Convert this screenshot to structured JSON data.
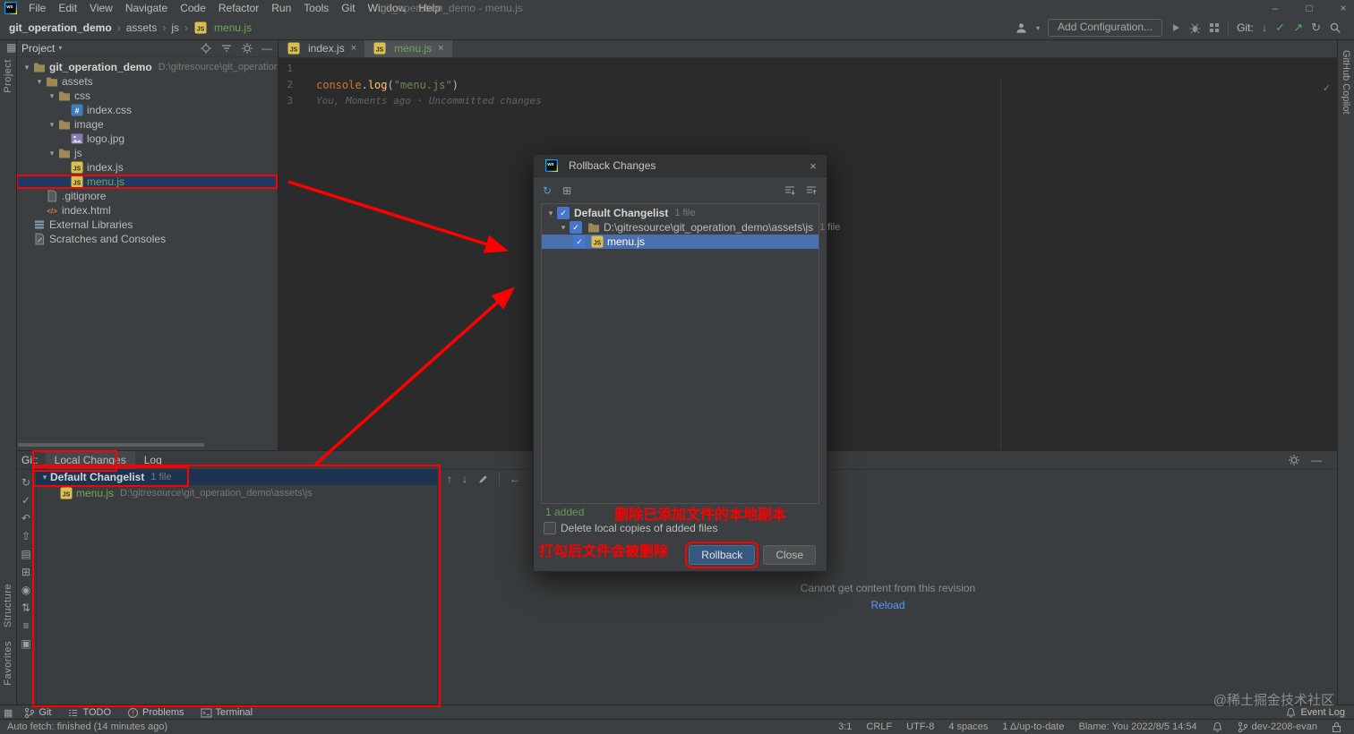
{
  "titlebar": {
    "menus": [
      "File",
      "Edit",
      "View",
      "Navigate",
      "Code",
      "Refactor",
      "Run",
      "Tools",
      "Git",
      "Window",
      "Help"
    ],
    "title": "git_operation_demo - menu.js",
    "controls": {
      "minimize": "–",
      "maximize": "□",
      "close": "×"
    }
  },
  "toolbar": {
    "breadcrumbs": [
      "git_operation_demo",
      "assets",
      "js",
      "menu.js"
    ],
    "add_configuration": "Add Configuration...",
    "git_label": "Git:"
  },
  "left_strip": {
    "project": "Project",
    "structure": "Structure",
    "favorites": "Favorites"
  },
  "right_strip": {
    "label": "GitHub Copilot"
  },
  "project_panel": {
    "title": "Project",
    "tree": [
      {
        "label": "git_operation_demo",
        "path": "D:\\gitresource\\git_operation_de"
      },
      {
        "label": "assets"
      },
      {
        "label": "css"
      },
      {
        "label": "index.css"
      },
      {
        "label": "image"
      },
      {
        "label": "logo.jpg"
      },
      {
        "label": "js"
      },
      {
        "label": "index.js"
      },
      {
        "label": "menu.js"
      },
      {
        "label": ".gitignore"
      },
      {
        "label": "index.html"
      },
      {
        "label": "External Libraries"
      },
      {
        "label": "Scratches and Consoles"
      }
    ]
  },
  "editor": {
    "tabs": [
      {
        "label": "index.js"
      },
      {
        "label": "menu.js"
      }
    ],
    "line_numbers": [
      "1",
      "2",
      "3"
    ],
    "code_tokens": [
      {
        "text": "console",
        "color": "#cc7832"
      },
      {
        "text": ".",
        "color": "#a9b7c6"
      },
      {
        "text": "log",
        "color": "#ffc66d"
      },
      {
        "text": "(",
        "color": "#a9b7c6"
      },
      {
        "text": "\"menu.js\"",
        "color": "#6a8759"
      },
      {
        "text": ")",
        "color": "#a9b7c6"
      }
    ],
    "blame": "You, Moments ago · Uncommitted changes"
  },
  "dialog": {
    "title": "Rollback Changes",
    "close": "×",
    "rows": [
      {
        "label": "Default Changelist",
        "extra": "1 file"
      },
      {
        "label": "D:\\gitresource\\git_operation_demo\\assets\\js",
        "extra": "1 file"
      },
      {
        "label": "menu.js"
      }
    ],
    "summary": "1 added",
    "checkbox_label": "Delete local copies of added files",
    "rollback_button": "Rollback",
    "close_button": "Close"
  },
  "git_panel": {
    "label": "Git:",
    "tabs": [
      "Local Changes",
      "Log"
    ],
    "changelist": {
      "label": "Default Changelist",
      "extra": "1 file"
    },
    "file": {
      "label": "menu.js",
      "path": "D:\\gitresource\\git_operation_demo\\assets\\js"
    },
    "preview": {
      "message": "Cannot get content from this revision",
      "action": "Reload"
    }
  },
  "annotations": {
    "note_right": "删除已添加文件的本地副本",
    "note_left": "打勾后文件会被删除"
  },
  "tool_tabs": {
    "git": "Git",
    "todo": "TODO",
    "problems": "Problems",
    "terminal": "Terminal",
    "event_log": "Event Log"
  },
  "watermark": "@稀土掘金技术社区",
  "statusbar": {
    "left": "Auto fetch: finished (14 minutes ago)",
    "cursor": "3:1",
    "line_sep": "CRLF",
    "encoding": "UTF-8",
    "indent": "4 spaces",
    "sync": "1 Δ/up-to-date",
    "blame": "Blame: You 2022/8/5 14:54",
    "branch": "dev-2208-evan"
  }
}
